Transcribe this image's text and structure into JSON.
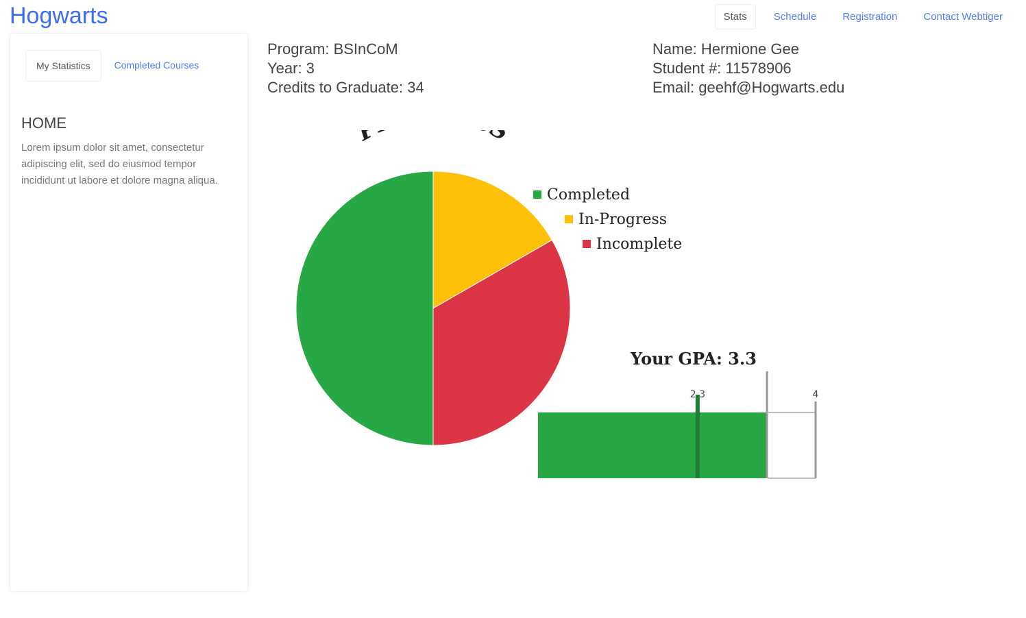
{
  "brand": "Hogwarts",
  "nav": {
    "items": [
      "Stats",
      "Schedule",
      "Registration",
      "Contact Webtiger"
    ],
    "active": 0
  },
  "sidebar": {
    "tabs": [
      "My Statistics",
      "Completed Courses"
    ],
    "active_tab": 0,
    "heading": "HOME",
    "body": "Lorem ipsum dolor sit amet, consectetur adipiscing elit, sed do eiusmod tempor incididunt ut labore et dolore magna aliqua."
  },
  "program_info": {
    "program": "Program: BSInCoM",
    "year": "Year: 3",
    "credits": "Credits to Graduate: 34"
  },
  "student_info": {
    "name": "Name: Hermione Gee",
    "student_number": "Student #: 11578906",
    "email": "Email: geehf@Hogwarts.edu"
  },
  "chart_data": [
    {
      "type": "pie",
      "title": "PROGRESS",
      "categories": [
        "Completed",
        "In-Progress",
        "Incomplete"
      ],
      "values": [
        50,
        16.7,
        33.3
      ],
      "colors": [
        "#28a745",
        "#ffc107",
        "#dc3545"
      ],
      "legend": "right"
    },
    {
      "type": "bar",
      "title": "Your GPA: 3.3",
      "orientation": "horizontal",
      "values": [
        3.3
      ],
      "xlim": [
        0,
        4
      ],
      "marker": 2.3,
      "tick_labels": [
        "2.3",
        "4"
      ],
      "colors": [
        "#28a745"
      ]
    }
  ]
}
